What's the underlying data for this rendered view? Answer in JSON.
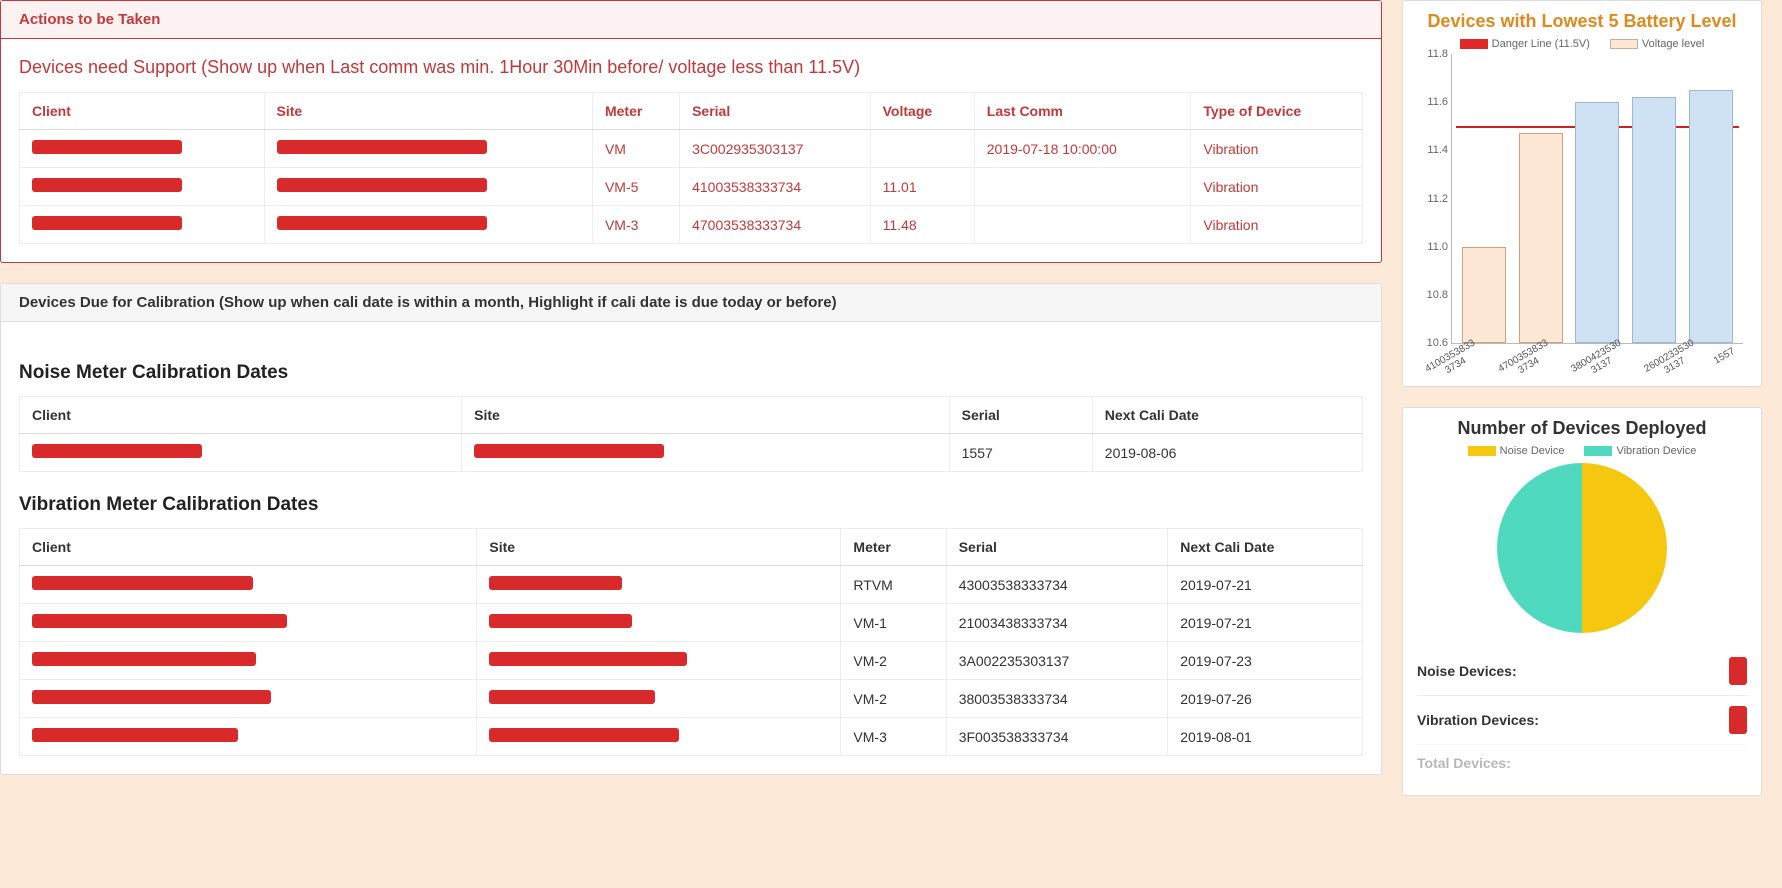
{
  "actions_panel": {
    "header": "Actions to be Taken",
    "subtitle": "Devices need Support (Show up when Last comm was min. 1Hour 30Min before/ voltage less than 11.5V)",
    "columns": [
      "Client",
      "Site",
      "Meter",
      "Serial",
      "Voltage",
      "Last Comm",
      "Type of Device"
    ],
    "rows": [
      {
        "meter": "VM",
        "serial": "3C002935303137",
        "voltage": "",
        "last_comm": "2019-07-18 10:00:00",
        "type": "Vibration"
      },
      {
        "meter": "VM-5",
        "serial": "41003538333734",
        "voltage": "11.01",
        "last_comm": "",
        "type": "Vibration"
      },
      {
        "meter": "VM-3",
        "serial": "47003538333734",
        "voltage": "11.48",
        "last_comm": "",
        "type": "Vibration"
      }
    ]
  },
  "cali_panel": {
    "header": "Devices Due for Calibration (Show up when cali date is within a month, Highlight if cali date is due today or before)",
    "noise": {
      "heading": "Noise Meter Calibration Dates",
      "columns": [
        "Client",
        "Site",
        "Serial",
        "Next Cali Date"
      ],
      "rows": [
        {
          "serial": "1557",
          "next": "2019-08-06"
        }
      ]
    },
    "vibration": {
      "heading": "Vibration Meter Calibration Dates",
      "columns": [
        "Client",
        "Site",
        "Meter",
        "Serial",
        "Next Cali Date"
      ],
      "rows": [
        {
          "meter": "RTVM",
          "serial": "43003538333734",
          "next": "2019-07-21"
        },
        {
          "meter": "VM-1",
          "serial": "21003438333734",
          "next": "2019-07-21"
        },
        {
          "meter": "VM-2",
          "serial": "3A002235303137",
          "next": "2019-07-23"
        },
        {
          "meter": "VM-2",
          "serial": "38003538333734",
          "next": "2019-07-26"
        },
        {
          "meter": "VM-3",
          "serial": "3F003538333734",
          "next": "2019-08-01"
        }
      ]
    }
  },
  "battery_chart": {
    "title": "Devices with Lowest 5 Battery Level",
    "legend": {
      "danger": "Danger Line (11.5V)",
      "voltage": "Voltage level"
    },
    "y_ticks": [
      "11.8",
      "11.6",
      "11.4",
      "11.2",
      "11.0",
      "10.8",
      "10.6"
    ]
  },
  "deploy_chart": {
    "title": "Number of Devices Deployed",
    "legend": {
      "noise": "Noise Device",
      "vibration": "Vibration Device"
    },
    "stats": {
      "noise_label": "Noise Devices:",
      "vibration_label": "Vibration Devices:",
      "total_label": "Total Devices:"
    }
  },
  "chart_data": [
    {
      "type": "bar",
      "title": "Devices with Lowest 5 Battery Level",
      "ylabel": "Voltage level",
      "ylim": [
        10.6,
        11.8
      ],
      "danger_line": 11.5,
      "categories": [
        "41003538333734",
        "47003538333734",
        "38004235303137",
        "26002335303137",
        "1557"
      ],
      "values": [
        11.0,
        11.47,
        11.6,
        11.62,
        11.65
      ],
      "below_danger_flags": [
        true,
        true,
        false,
        false,
        false
      ]
    },
    {
      "type": "pie",
      "title": "Number of Devices Deployed",
      "series": [
        {
          "name": "Noise Device",
          "value": 50,
          "color": "#f5c80f"
        },
        {
          "name": "Vibration Device",
          "value": 50,
          "color": "#4fdabf"
        }
      ]
    }
  ]
}
